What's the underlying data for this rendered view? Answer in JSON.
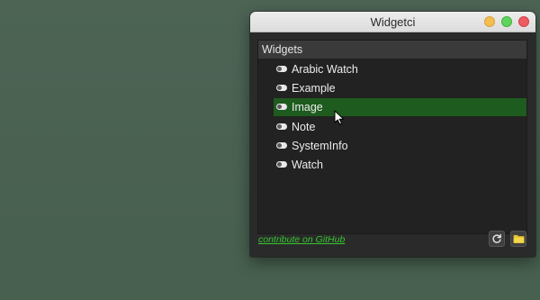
{
  "window": {
    "title": "Widgetci"
  },
  "panel": {
    "header": "Widgets",
    "items": [
      {
        "label": "Arabic Watch",
        "enabled": true,
        "selected": false
      },
      {
        "label": "Example",
        "enabled": true,
        "selected": false
      },
      {
        "label": "Image",
        "enabled": true,
        "selected": true
      },
      {
        "label": "Note",
        "enabled": true,
        "selected": false
      },
      {
        "label": "SystemInfo",
        "enabled": true,
        "selected": false
      },
      {
        "label": "Watch",
        "enabled": true,
        "selected": false
      }
    ]
  },
  "footer": {
    "link_text": "contribute on GitHub",
    "buttons": [
      {
        "icon": "refresh-icon"
      },
      {
        "icon": "folder-icon"
      }
    ]
  },
  "colors": {
    "desktop": "#4a6152",
    "selection": "#1e5b1e",
    "link": "#37c62f",
    "folder": "#e9c93a"
  }
}
